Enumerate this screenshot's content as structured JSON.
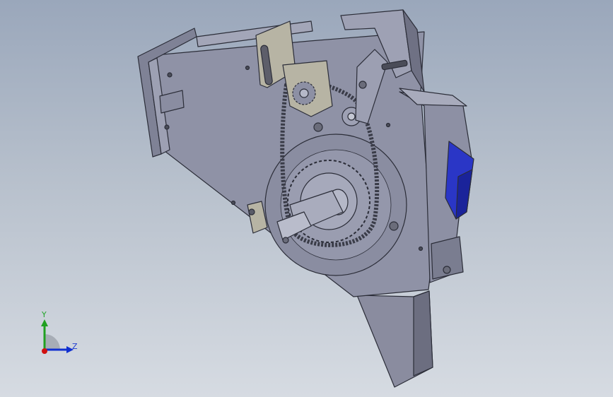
{
  "triad": {
    "y_label": "Y",
    "z_label": "Z",
    "colors": {
      "x": "#d01010",
      "y": "#20a020",
      "z": "#1030d0"
    }
  },
  "model": {
    "body_color": "#7d7f93",
    "accent_color": "#2130c0",
    "chain_color": "#3a3c48"
  }
}
